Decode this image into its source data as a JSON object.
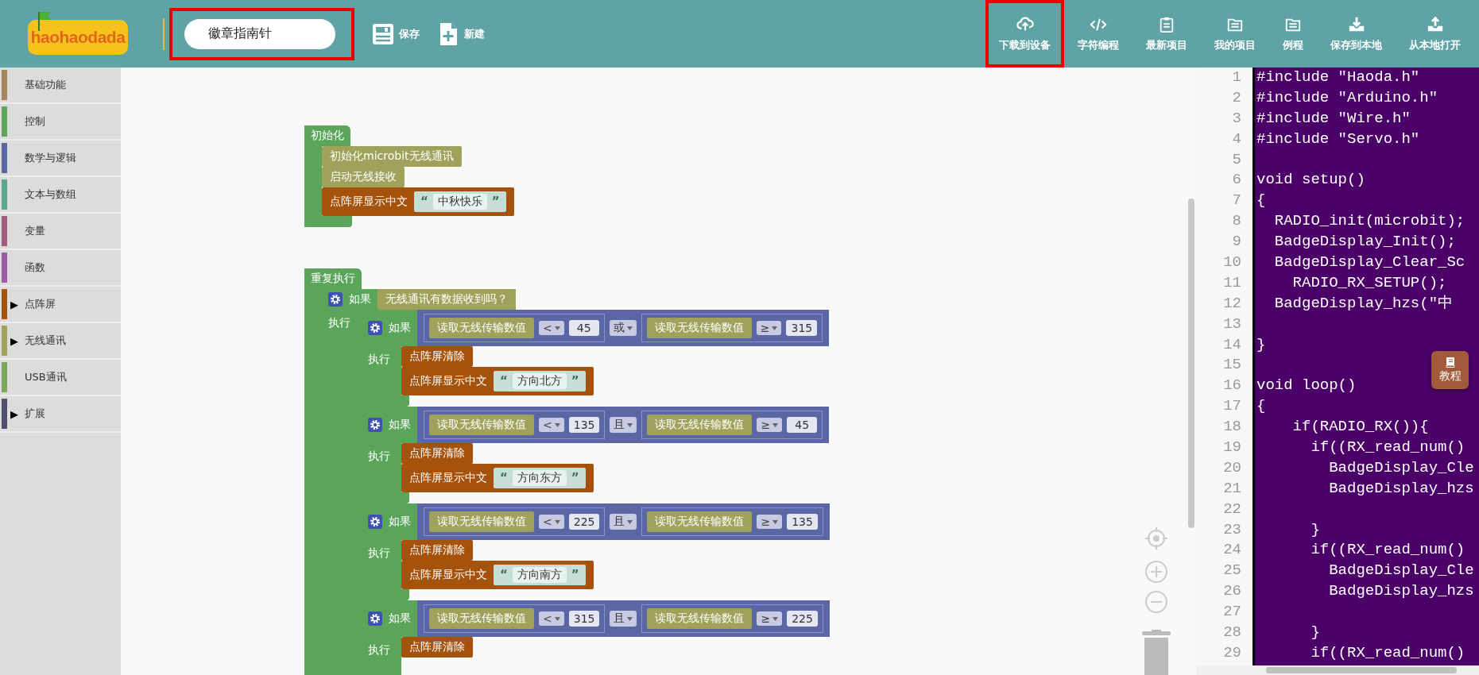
{
  "header": {
    "logo": "haohaodada",
    "title_field": {
      "value": "徽章指南针",
      "highlighted": true
    },
    "actions": [
      {
        "label": "保存"
      },
      {
        "label": "新建"
      }
    ],
    "toolbar": [
      {
        "label": "下载到设备",
        "highlighted": true
      },
      {
        "label": "字符编程",
        "highlighted": false
      },
      {
        "label": "最新项目",
        "highlighted": false
      },
      {
        "label": "我的项目",
        "highlighted": false
      },
      {
        "label": "例程",
        "highlighted": false
      },
      {
        "label": "保存到本地",
        "highlighted": false
      },
      {
        "label": "从本地打开",
        "highlighted": false
      }
    ]
  },
  "sidebar": {
    "items": [
      {
        "label": "基础功能",
        "color": "#a5835b"
      },
      {
        "label": "控制",
        "color": "#5ba55b"
      },
      {
        "label": "数学与逻辑",
        "color": "#5b67a5"
      },
      {
        "label": "文本与数组",
        "color": "#5ba58c"
      },
      {
        "label": "变量",
        "color": "#a55b80"
      },
      {
        "label": "函数",
        "color": "#995ba5"
      },
      {
        "label": "点阵屏",
        "color": "#a5520c",
        "toggle": "▶"
      },
      {
        "label": "无线通讯",
        "color": "#a0a25c",
        "toggle": "▶"
      },
      {
        "label": "USB通讯",
        "color": "#80a55b"
      },
      {
        "label": "扩展",
        "color": "#4d4d70",
        "toggle": "▶"
      }
    ]
  },
  "workspace": {
    "stacks": [
      {
        "kind": "hat",
        "label": "初始化",
        "closed": true,
        "body": [
          {
            "kind": "radio",
            "label": "初始化microbit无线通讯"
          },
          {
            "kind": "radio",
            "label": "启动无线接收"
          },
          {
            "kind": "matrix",
            "label": "点阵屏显示中文",
            "text": {
              "open": "“",
              "value": "中秋快乐",
              "close": "”"
            }
          }
        ]
      },
      {
        "kind": "hat",
        "label": "重复执行",
        "closed": false,
        "body": [
          {
            "kind": "if",
            "label": "如果",
            "do_label": "执行",
            "cond": {
              "kind": "radio",
              "label": "无线通讯有数据收到吗？"
            },
            "body": [
              {
                "kind": "if",
                "label": "如果",
                "do_label": "执行",
                "closed": true,
                "cond": {
                  "kind": "logic",
                  "op": "或",
                  "left": {
                    "kind": "compare",
                    "reader": "读取无线传输数值",
                    "op": "<",
                    "value": "45"
                  },
                  "right": {
                    "kind": "compare",
                    "reader": "读取无线传输数值",
                    "op": "≥",
                    "value": "315"
                  }
                },
                "body": [
                  {
                    "kind": "matrix",
                    "label": "点阵屏清除"
                  },
                  {
                    "kind": "matrix",
                    "label": "点阵屏显示中文",
                    "text": {
                      "open": "“",
                      "value": "方向北方",
                      "close": "”"
                    }
                  }
                ]
              },
              {
                "kind": "if",
                "label": "如果",
                "do_label": "执行",
                "closed": true,
                "cond": {
                  "kind": "logic",
                  "op": "且",
                  "left": {
                    "kind": "compare",
                    "reader": "读取无线传输数值",
                    "op": "<",
                    "value": "135"
                  },
                  "right": {
                    "kind": "compare",
                    "reader": "读取无线传输数值",
                    "op": "≥",
                    "value": "45"
                  }
                },
                "body": [
                  {
                    "kind": "matrix",
                    "label": "点阵屏清除"
                  },
                  {
                    "kind": "matrix",
                    "label": "点阵屏显示中文",
                    "text": {
                      "open": "“",
                      "value": "方向东方",
                      "close": "”"
                    }
                  }
                ]
              },
              {
                "kind": "if",
                "label": "如果",
                "do_label": "执行",
                "closed": true,
                "cond": {
                  "kind": "logic",
                  "op": "且",
                  "left": {
                    "kind": "compare",
                    "reader": "读取无线传输数值",
                    "op": "<",
                    "value": "225"
                  },
                  "right": {
                    "kind": "compare",
                    "reader": "读取无线传输数值",
                    "op": "≥",
                    "value": "135"
                  }
                },
                "body": [
                  {
                    "kind": "matrix",
                    "label": "点阵屏清除"
                  },
                  {
                    "kind": "matrix",
                    "label": "点阵屏显示中文",
                    "text": {
                      "open": "“",
                      "value": "方向南方",
                      "close": "”"
                    }
                  }
                ]
              },
              {
                "kind": "if",
                "label": "如果",
                "do_label": "执行",
                "closed": false,
                "cond": {
                  "kind": "logic",
                  "op": "且",
                  "left": {
                    "kind": "compare",
                    "reader": "读取无线传输数值",
                    "op": "<",
                    "value": "315"
                  },
                  "right": {
                    "kind": "compare",
                    "reader": "读取无线传输数值",
                    "op": "≥",
                    "value": "225"
                  }
                },
                "body": [
                  {
                    "kind": "matrix",
                    "label": "点阵屏清除"
                  }
                ]
              }
            ]
          }
        ]
      }
    ]
  },
  "code": {
    "lines": [
      {
        "n": "1",
        "text": "#include \"Haoda.h\""
      },
      {
        "n": "2",
        "text": "#include \"Arduino.h\""
      },
      {
        "n": "3",
        "text": "#include \"Wire.h\""
      },
      {
        "n": "4",
        "text": "#include \"Servo.h\""
      },
      {
        "n": "5"
      },
      {
        "n": "6",
        "text": "void setup()"
      },
      {
        "n": "7",
        "text": "{"
      },
      {
        "n": "8",
        "text": "  RADIO_init(microbit);"
      },
      {
        "n": "9",
        "text": "  BadgeDisplay_Init();"
      },
      {
        "n": "10",
        "text": "  BadgeDisplay_Clear_Sc"
      },
      {
        "n": "11",
        "text": "    RADIO_RX_SETUP();"
      },
      {
        "n": "12",
        "text": "  BadgeDisplay_hzs(\"中"
      },
      {
        "n": "13"
      },
      {
        "n": "14",
        "text": "}"
      },
      {
        "n": "15"
      },
      {
        "n": "16",
        "text": "void loop()"
      },
      {
        "n": "17",
        "text": "{"
      },
      {
        "n": "18",
        "text": "    if(RADIO_RX()){"
      },
      {
        "n": "19",
        "text": "      if((RX_read_num()"
      },
      {
        "n": "20",
        "text": "        BadgeDisplay_Cle"
      },
      {
        "n": "21",
        "text": "        BadgeDisplay_hzs"
      },
      {
        "n": "22"
      },
      {
        "n": "23",
        "text": "      }"
      },
      {
        "n": "24",
        "text": "      if((RX_read_num()"
      },
      {
        "n": "25",
        "text": "        BadgeDisplay_Cle"
      },
      {
        "n": "26",
        "text": "        BadgeDisplay_hzs"
      },
      {
        "n": "27"
      },
      {
        "n": "28",
        "text": "      }"
      },
      {
        "n": "29",
        "text": "      if((RX_read_num()"
      }
    ],
    "tutorial_button": {
      "label": "教程"
    }
  }
}
